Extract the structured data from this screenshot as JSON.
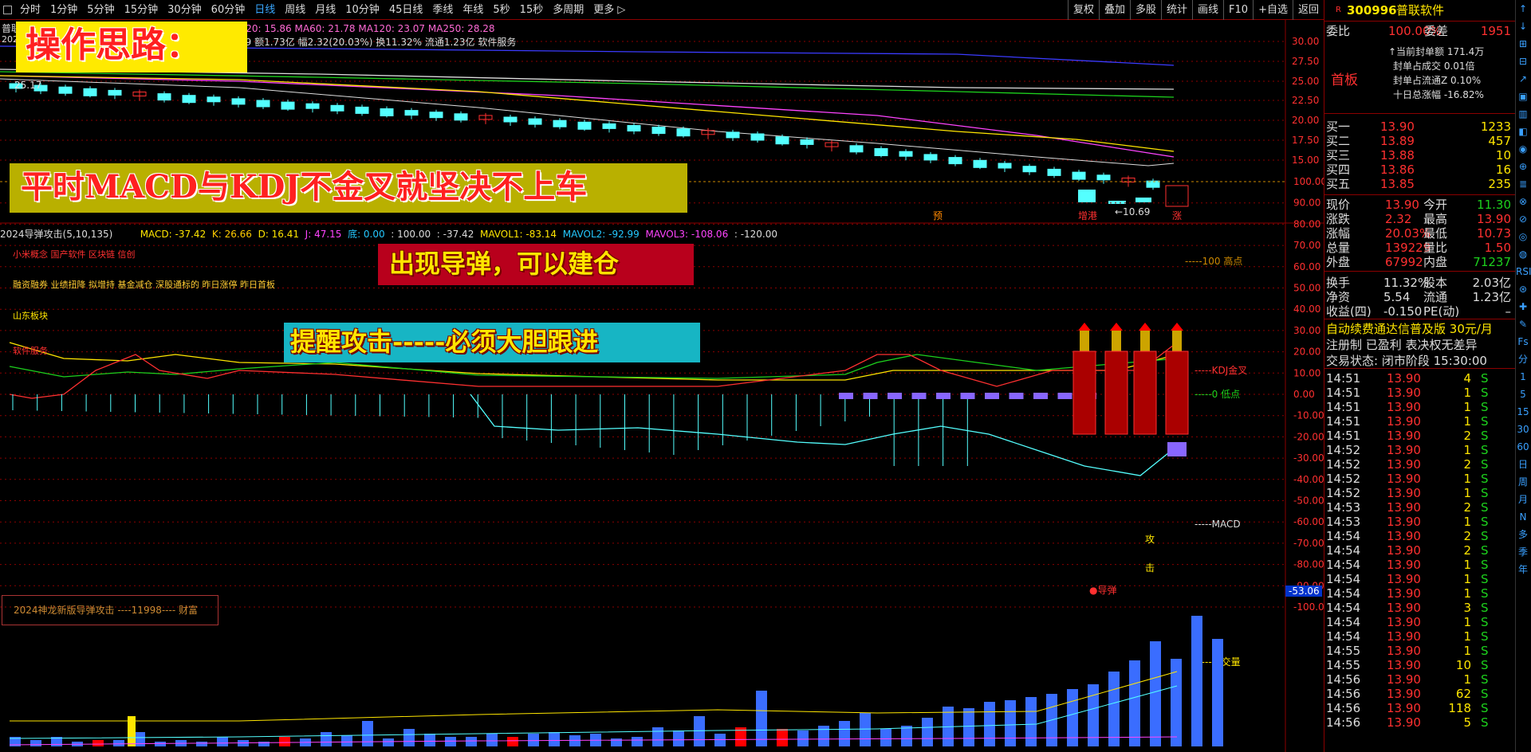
{
  "toolbar": {
    "periods": [
      "分时",
      "1分钟",
      "5分钟",
      "15分钟",
      "30分钟",
      "60分钟",
      "日线",
      "周线",
      "月线",
      "10分钟",
      "45日线",
      "季线",
      "年线",
      "5秒",
      "15秒",
      "多周期",
      "更多 ▷"
    ],
    "active_period": "日线",
    "tools": [
      "复权",
      "叠加",
      "多股",
      "统计",
      "画线",
      "F10",
      "+自选",
      "返回"
    ]
  },
  "main_header": {
    "stock_short": "普联",
    "ma_line": "A20: 15.86  MA60: 21.78  MA120: 23.07  MA250: 28.28",
    "line2_left": "202",
    "line2": "29 额1.73亿  幅2.32(20.03%) 换11.32% 流通1.23亿 软件服务"
  },
  "price_axis": [
    "30.00",
    "27.50",
    "25.00",
    "22.50",
    "20.00",
    "17.50",
    "15.00"
  ],
  "chart_marks": {
    "low_label": "←10.69",
    "left_price": "25.17",
    "tag1": "预",
    "tag2": "增港",
    "tag3": "涨"
  },
  "annotations": {
    "a1": "操作思路：",
    "a2": "平时MACD与KDJ不金叉就坚决不上车",
    "a3": "出现导弹，可以建仓",
    "a4": "提醒攻击-----必须大胆跟进"
  },
  "indicator_header": {
    "name": "2024导弹攻击(5,10,135)",
    "macd": "MACD: -37.42",
    "k": "K: 26.66",
    "d": "D: 16.41",
    "j": "J: 47.15",
    "di": "底: 0.00",
    "v100": ": 100.00",
    "vm": ": -37.42",
    "mavol1": "MAVOL1: -83.14",
    "mavol2": "MAVOL2: -92.99",
    "mavol3": "MAVOL3: -108.06",
    "v120": ": -120.00"
  },
  "concepts": {
    "c1": "小米概念 国产软件 区块链 信创",
    "c2": "融资融券 业绩扭降 拟增持 基金减仓 深股通标的 昨日涨停 昨日首板",
    "c3": "山东板块",
    "c4": "软件服务"
  },
  "ind_axis": [
    "100.00",
    "90.00",
    "80.00",
    "70.00",
    "60.00",
    "50.00",
    "40.00",
    "30.00",
    "20.00",
    "10.00",
    "0.00",
    "-10.00",
    "-20.00",
    "-30.00",
    "-40.00",
    "-50.00",
    "-60.00",
    "-70.00",
    "-80.00",
    "-90.00",
    "-100.00"
  ],
  "ind_labels": {
    "high": "-----100 高点",
    "kdj": "-----KDJ金叉",
    "low": "-----0 低点",
    "macd": "-----MACD",
    "vol": "-----成交量",
    "current": "-53.06",
    "missile": "●导弹",
    "attack1": "攻",
    "attack2": "击"
  },
  "brand": "2024神龙新版导弹攻击   ----11998---- 财富",
  "quote": {
    "code": "300996",
    "name": "普联软件",
    "weibi_label": "委比",
    "weibi": "100.00%",
    "weicha_label": "委差",
    "weicha": "1951",
    "seal_amount": "↑当前封单额  171.4万",
    "seal_deal": "封单占成交  0.01倍",
    "seal_float": "封单占流通Z  0.10%",
    "ten_day": "十日总涨幅  -16.82%",
    "first_board": "首板"
  },
  "bids": [
    {
      "label": "买一",
      "price": "13.90",
      "vol": "1233"
    },
    {
      "label": "买二",
      "price": "13.89",
      "vol": "457"
    },
    {
      "label": "买三",
      "price": "13.88",
      "vol": "10"
    },
    {
      "label": "买四",
      "price": "13.86",
      "vol": "16"
    },
    {
      "label": "买五",
      "price": "13.85",
      "vol": "235"
    }
  ],
  "stats": [
    {
      "l1": "现价",
      "v1": "13.90",
      "l2": "今开",
      "v2": "11.30"
    },
    {
      "l1": "涨跌",
      "v1": "2.32",
      "l2": "最高",
      "v2": "13.90"
    },
    {
      "l1": "涨幅",
      "v1": "20.03%",
      "l2": "最低",
      "v2": "10.73"
    },
    {
      "l1": "总量",
      "v1": "139229",
      "l2": "量比",
      "v2": "1.50"
    },
    {
      "l1": "外盘",
      "v1": "67992",
      "l2": "内盘",
      "v2": "71237"
    }
  ],
  "stats2": [
    {
      "l1": "换手",
      "v1": "11.32%",
      "l2": "股本",
      "v2": "2.03亿"
    },
    {
      "l1": "净资",
      "v1": "5.54",
      "l2": "流通",
      "v2": "1.23亿"
    },
    {
      "l1": "收益(四)",
      "v1": "-0.150",
      "l2": "PE(动)",
      "v2": "–"
    }
  ],
  "promo": "自动续费通达信普及版  30元/月",
  "reg": "注册制 已盈利 表决权无差异",
  "trade_state": "交易状态: 闭市阶段 15:30:00",
  "ticks": [
    {
      "t": "14:51",
      "p": "13.90",
      "v": "4",
      "s": "S"
    },
    {
      "t": "14:51",
      "p": "13.90",
      "v": "1",
      "s": "S"
    },
    {
      "t": "14:51",
      "p": "13.90",
      "v": "1",
      "s": "S"
    },
    {
      "t": "14:51",
      "p": "13.90",
      "v": "1",
      "s": "S"
    },
    {
      "t": "14:51",
      "p": "13.90",
      "v": "2",
      "s": "S"
    },
    {
      "t": "14:52",
      "p": "13.90",
      "v": "1",
      "s": "S"
    },
    {
      "t": "14:52",
      "p": "13.90",
      "v": "2",
      "s": "S"
    },
    {
      "t": "14:52",
      "p": "13.90",
      "v": "1",
      "s": "S"
    },
    {
      "t": "14:52",
      "p": "13.90",
      "v": "1",
      "s": "S"
    },
    {
      "t": "14:53",
      "p": "13.90",
      "v": "2",
      "s": "S"
    },
    {
      "t": "14:53",
      "p": "13.90",
      "v": "1",
      "s": "S"
    },
    {
      "t": "14:54",
      "p": "13.90",
      "v": "2",
      "s": "S"
    },
    {
      "t": "14:54",
      "p": "13.90",
      "v": "2",
      "s": "S"
    },
    {
      "t": "14:54",
      "p": "13.90",
      "v": "1",
      "s": "S"
    },
    {
      "t": "14:54",
      "p": "13.90",
      "v": "1",
      "s": "S"
    },
    {
      "t": "14:54",
      "p": "13.90",
      "v": "1",
      "s": "S"
    },
    {
      "t": "14:54",
      "p": "13.90",
      "v": "3",
      "s": "S"
    },
    {
      "t": "14:54",
      "p": "13.90",
      "v": "1",
      "s": "S"
    },
    {
      "t": "14:54",
      "p": "13.90",
      "v": "1",
      "s": "S"
    },
    {
      "t": "14:55",
      "p": "13.90",
      "v": "1",
      "s": "S"
    },
    {
      "t": "14:55",
      "p": "13.90",
      "v": "10",
      "s": "S"
    },
    {
      "t": "14:56",
      "p": "13.90",
      "v": "1",
      "s": "S"
    },
    {
      "t": "14:56",
      "p": "13.90",
      "v": "62",
      "s": "S"
    },
    {
      "t": "14:56",
      "p": "13.90",
      "v": "118",
      "s": "S"
    },
    {
      "t": "14:56",
      "p": "13.90",
      "v": "5",
      "s": "S"
    }
  ],
  "side_icons": [
    "↑",
    "↓",
    "⊞",
    "⊟",
    "↗",
    "▣",
    "▥",
    "◧",
    "◉",
    "⊕",
    "≣",
    "⊗",
    "⊘",
    "◎",
    "◍",
    "RSI",
    "⊛",
    "✚",
    "✎",
    "Fs",
    "分",
    "1",
    "5",
    "15",
    "30",
    "60",
    "日",
    "周",
    "月",
    "N",
    "多",
    "季",
    "年"
  ]
}
